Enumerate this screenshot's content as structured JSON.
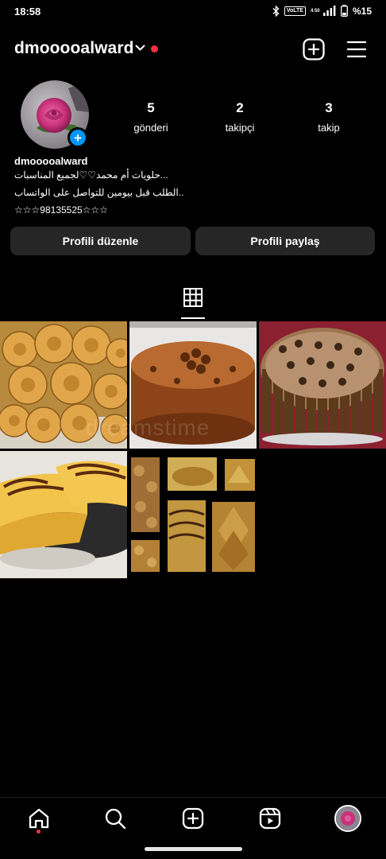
{
  "status_bar": {
    "time": "18:58",
    "network_badge": "VoLTE",
    "net_speed": "4.50",
    "battery_text": "%15",
    "icons": [
      "bluetooth-icon",
      "signal-icon",
      "battery-icon"
    ]
  },
  "header": {
    "username": "dmooooalward",
    "icons": [
      "chevron-down-icon",
      "notification-dot",
      "add-post-icon",
      "menu-icon"
    ]
  },
  "profile": {
    "avatar_icon": "rose-avatar",
    "add_story_symbol": "+",
    "stats": [
      {
        "value": "5",
        "label": "gönderi"
      },
      {
        "value": "2",
        "label": "takipçi"
      },
      {
        "value": "3",
        "label": "takip"
      }
    ],
    "name": "dmooooalward",
    "bio_lines": [
      "حلويات أم محمد♡♡لجميع المناسبات...",
      "الطلب قبل بيومين للتواصل على الواتساب..",
      "☆☆☆98135525☆☆☆"
    ]
  },
  "buttons": {
    "edit_profile": "Profili düzenle",
    "share_profile": "Profili paylaş"
  },
  "tabs": {
    "icons": [
      "grid-icon"
    ]
  },
  "posts": [
    {
      "name": "sesame-ring-cookies"
    },
    {
      "name": "caramel-cake"
    },
    {
      "name": "kitkat-maltesers-cake"
    },
    {
      "name": "marble-sponge-cake"
    },
    {
      "name": "sweets-collage"
    }
  ],
  "watermark": "dreamstime",
  "bottom_nav": {
    "icons": [
      "home-icon",
      "search-icon",
      "create-icon",
      "reels-icon",
      "profile-avatar"
    ]
  },
  "colors": {
    "background": "#000000",
    "button": "#262626",
    "accent_blue": "#0095f6",
    "notification_red": "#ff3040"
  }
}
